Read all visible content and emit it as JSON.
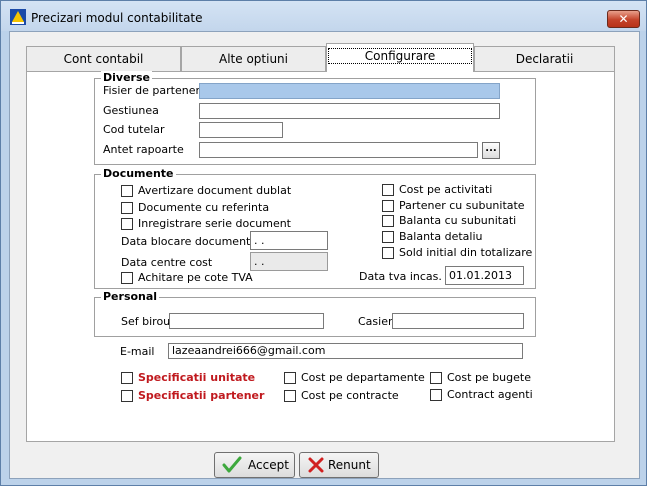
{
  "window": {
    "title": "Precizari modul contabilitate",
    "close_label": "✕"
  },
  "tabs": [
    {
      "label": "Cont contabil"
    },
    {
      "label": "Alte optiuni"
    },
    {
      "label": "Configurare"
    },
    {
      "label": "Declaratii"
    }
  ],
  "diverse": {
    "title": "Diverse",
    "fisier_label": "Fisier de parteneri",
    "fisier_value": "",
    "gestiunea_label": "Gestiunea",
    "gestiunea_value": "",
    "cod_tutelar_label": "Cod tutelar",
    "cod_tutelar_value": "",
    "antet_label": "Antet rapoarte",
    "antet_value": "",
    "browse_label": "..."
  },
  "documente": {
    "title": "Documente",
    "left_checks": [
      {
        "label": "Avertizare document dublat",
        "checked": false
      },
      {
        "label": "Documente cu referinta",
        "checked": false
      },
      {
        "label": "Inregistrare serie document",
        "checked": false
      }
    ],
    "data_blocare_label": "Data blocare documente",
    "data_blocare_value": " . .",
    "data_centre_label": "Data centre cost",
    "data_centre_value": " . .",
    "achitare_label": "Achitare pe cote TVA",
    "right_checks": [
      {
        "label": "Cost pe activitati",
        "checked": false
      },
      {
        "label": "Partener cu subunitate",
        "checked": false
      },
      {
        "label": "Balanta cu subunitati",
        "checked": false
      },
      {
        "label": "Balanta detaliu",
        "checked": false
      },
      {
        "label": "Sold initial din totalizare",
        "checked": false
      }
    ],
    "data_tva_label": "Data tva incas.",
    "data_tva_value": "01.01.2013"
  },
  "personal": {
    "title": "Personal",
    "sef_label": "Sef birou",
    "sef_value": "",
    "casier_label": "Casier",
    "casier_value": ""
  },
  "email": {
    "label": "E-mail",
    "value": "lazeaandrei666@gmail.com"
  },
  "bottom_checks": {
    "spec_unitate": "Specificatii unitate",
    "spec_partener": "Specificatii partener",
    "cost_departamente": "Cost pe departamente",
    "cost_contracte": "Cost pe contracte",
    "cost_bugete": "Cost pe bugete",
    "contract_agenti": "Contract agenti"
  },
  "buttons": {
    "accept": "Accept",
    "renunt": "Renunt"
  },
  "colors": {
    "accent_red": "#c0191e",
    "check_green": "#3da83d"
  }
}
